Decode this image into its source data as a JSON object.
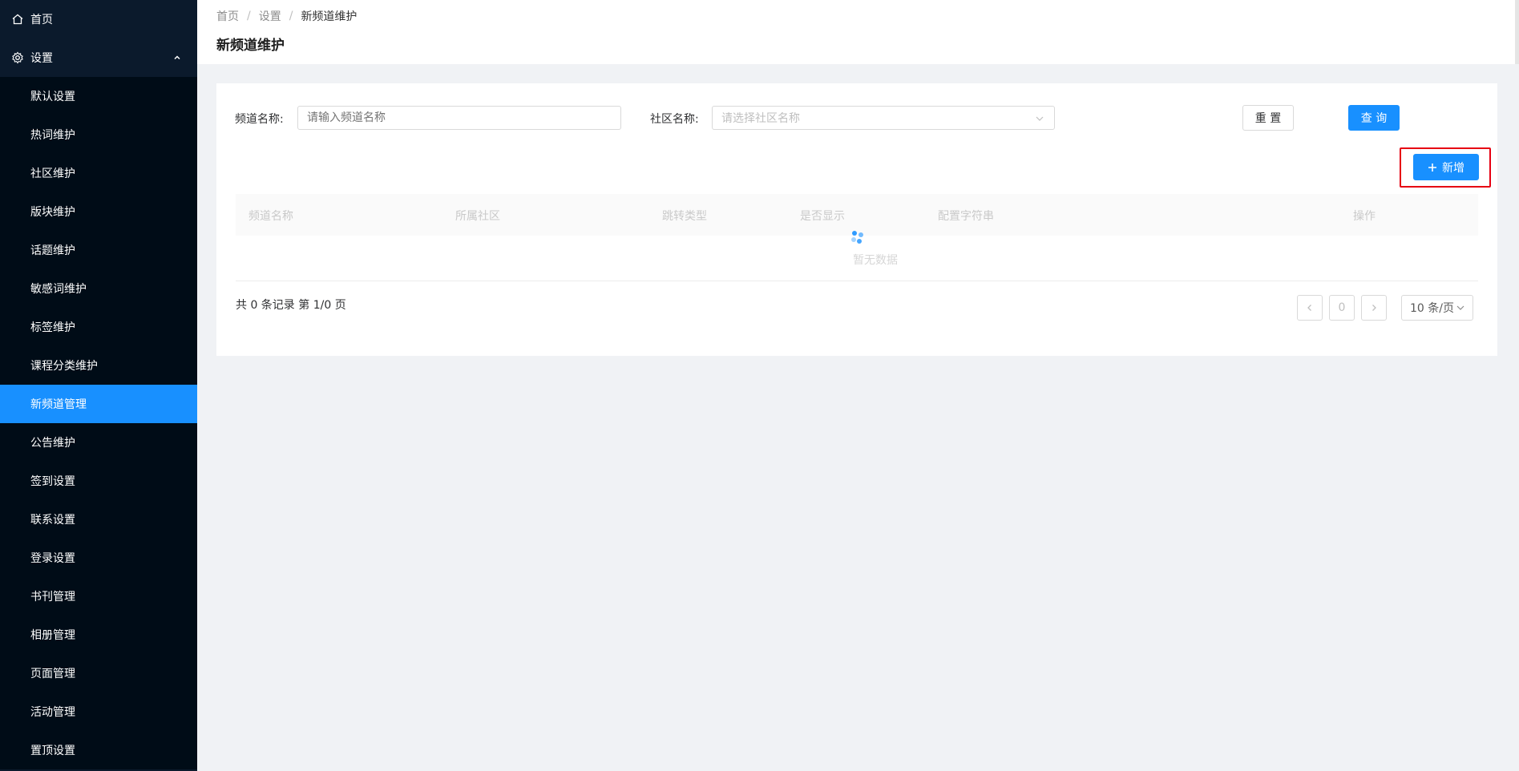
{
  "sidebar": {
    "home": {
      "label": "首页",
      "icon": "home-icon"
    },
    "settings": {
      "label": "设置",
      "icon": "gear-icon",
      "caret_icon": "chevron-up-icon"
    },
    "items": [
      {
        "label": "默认设置"
      },
      {
        "label": "热词维护"
      },
      {
        "label": "社区维护"
      },
      {
        "label": "版块维护"
      },
      {
        "label": "话题维护"
      },
      {
        "label": "敏感词维护"
      },
      {
        "label": "标签维护"
      },
      {
        "label": "课程分类维护"
      },
      {
        "label": "新频道管理",
        "active": true
      },
      {
        "label": "公告维护"
      },
      {
        "label": "签到设置"
      },
      {
        "label": "联系设置"
      },
      {
        "label": "登录设置"
      },
      {
        "label": "书刊管理"
      },
      {
        "label": "相册管理"
      },
      {
        "label": "页面管理"
      },
      {
        "label": "活动管理"
      },
      {
        "label": "置顶设置"
      }
    ],
    "active_color": "#1890ff"
  },
  "breadcrumb": {
    "items": [
      "首页",
      "设置",
      "新频道维护"
    ],
    "separator": "/"
  },
  "page_title": "新频道维护",
  "filters": {
    "channel_label": "频道名称:",
    "channel_placeholder": "请输入频道名称",
    "community_label": "社区名称:",
    "community_placeholder": "请选择社区名称"
  },
  "buttons": {
    "reset": "重 置",
    "query": "查 询",
    "add": "新增",
    "add_icon": "plus-icon"
  },
  "table": {
    "columns": [
      "频道名称",
      "所属社区",
      "跳转类型",
      "是否显示",
      "配置字符串",
      "操作"
    ],
    "empty_text": "暂无数据",
    "loading_icon": "loading-spinner-icon"
  },
  "pagination": {
    "total_text": "共 0 条记录 第 1/0 页",
    "current_page": "0",
    "page_size": "10 条/页",
    "prev_icon": "chevron-left-icon",
    "next_icon": "chevron-right-icon"
  },
  "colors": {
    "primary": "#1890ff",
    "sidebar_bg": "#0b1a2c",
    "highlight": "#e60012"
  }
}
